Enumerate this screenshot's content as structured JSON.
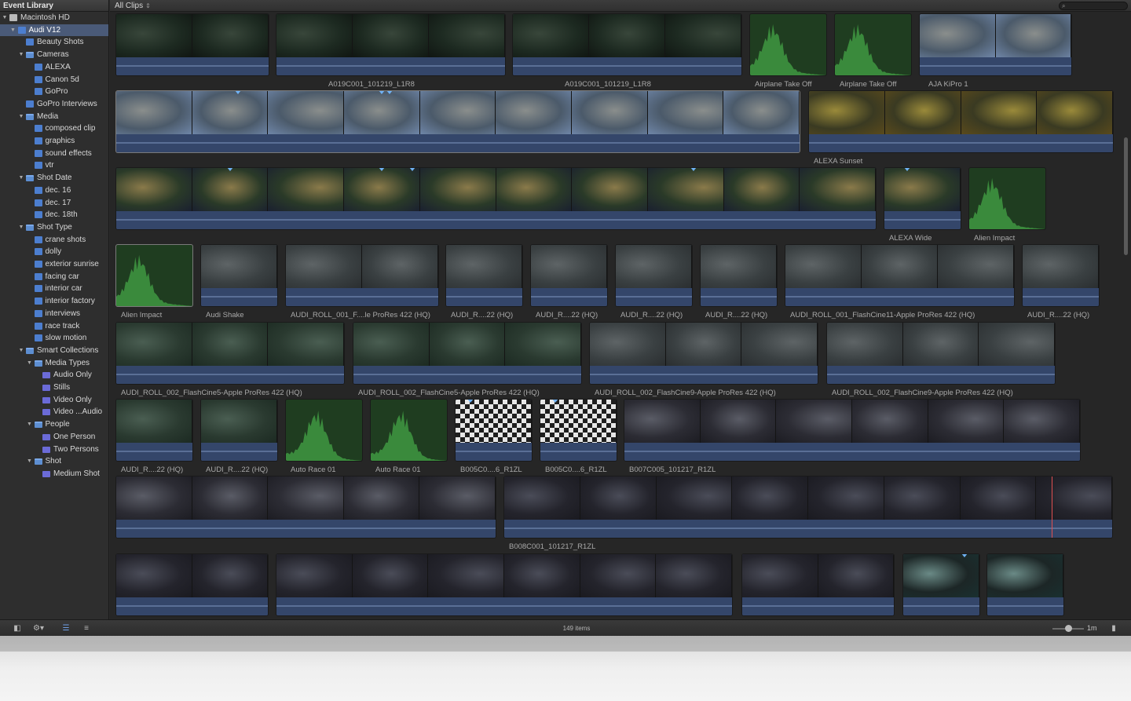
{
  "sidebar": {
    "header": "Event Library",
    "items": [
      {
        "label": "Macintosh HD",
        "depth": 0,
        "icon": "hard-drive-icon",
        "expanded": true,
        "selected": false
      },
      {
        "label": "Audi V12",
        "depth": 1,
        "icon": "event-icon",
        "expanded": true,
        "selected": true
      },
      {
        "label": "Beauty Shots",
        "depth": 2,
        "icon": "keyword-collection-icon",
        "expanded": null,
        "selected": false
      },
      {
        "label": "Cameras",
        "depth": 2,
        "icon": "folder-icon",
        "expanded": true,
        "selected": false
      },
      {
        "label": "ALEXA",
        "depth": 3,
        "icon": "keyword-collection-icon",
        "expanded": null,
        "selected": false
      },
      {
        "label": "Canon 5d",
        "depth": 3,
        "icon": "keyword-collection-icon",
        "expanded": null,
        "selected": false
      },
      {
        "label": "GoPro",
        "depth": 3,
        "icon": "keyword-collection-icon",
        "expanded": null,
        "selected": false
      },
      {
        "label": "GoPro Interviews",
        "depth": 2,
        "icon": "keyword-collection-icon",
        "expanded": null,
        "selected": false
      },
      {
        "label": "Media",
        "depth": 2,
        "icon": "folder-icon",
        "expanded": true,
        "selected": false
      },
      {
        "label": "composed clip",
        "depth": 3,
        "icon": "keyword-collection-icon",
        "expanded": null,
        "selected": false
      },
      {
        "label": "graphics",
        "depth": 3,
        "icon": "keyword-collection-icon",
        "expanded": null,
        "selected": false
      },
      {
        "label": "sound effects",
        "depth": 3,
        "icon": "keyword-collection-icon",
        "expanded": null,
        "selected": false
      },
      {
        "label": "vtr",
        "depth": 3,
        "icon": "keyword-collection-icon",
        "expanded": null,
        "selected": false
      },
      {
        "label": "Shot Date",
        "depth": 2,
        "icon": "folder-icon",
        "expanded": true,
        "selected": false
      },
      {
        "label": "dec. 16",
        "depth": 3,
        "icon": "keyword-collection-icon",
        "expanded": null,
        "selected": false
      },
      {
        "label": "dec. 17",
        "depth": 3,
        "icon": "keyword-collection-icon",
        "expanded": null,
        "selected": false
      },
      {
        "label": "dec. 18th",
        "depth": 3,
        "icon": "keyword-collection-icon",
        "expanded": null,
        "selected": false
      },
      {
        "label": "Shot Type",
        "depth": 2,
        "icon": "folder-icon",
        "expanded": true,
        "selected": false
      },
      {
        "label": "crane shots",
        "depth": 3,
        "icon": "keyword-collection-icon",
        "expanded": null,
        "selected": false
      },
      {
        "label": "dolly",
        "depth": 3,
        "icon": "keyword-collection-icon",
        "expanded": null,
        "selected": false
      },
      {
        "label": "exterior sunrise",
        "depth": 3,
        "icon": "keyword-collection-icon",
        "expanded": null,
        "selected": false
      },
      {
        "label": "facing car",
        "depth": 3,
        "icon": "keyword-collection-icon",
        "expanded": null,
        "selected": false
      },
      {
        "label": "interior car",
        "depth": 3,
        "icon": "keyword-collection-icon",
        "expanded": null,
        "selected": false
      },
      {
        "label": "interior factory",
        "depth": 3,
        "icon": "keyword-collection-icon",
        "expanded": null,
        "selected": false
      },
      {
        "label": "interviews",
        "depth": 3,
        "icon": "keyword-collection-icon",
        "expanded": null,
        "selected": false
      },
      {
        "label": "race track",
        "depth": 3,
        "icon": "keyword-collection-icon",
        "expanded": null,
        "selected": false
      },
      {
        "label": "slow motion",
        "depth": 3,
        "icon": "keyword-collection-icon",
        "expanded": null,
        "selected": false
      },
      {
        "label": "Smart Collections",
        "depth": 2,
        "icon": "folder-icon",
        "expanded": true,
        "selected": false
      },
      {
        "label": "Media Types",
        "depth": 3,
        "icon": "folder-icon",
        "expanded": true,
        "selected": false
      },
      {
        "label": "Audio Only",
        "depth": 4,
        "icon": "smart-collection-icon",
        "expanded": null,
        "selected": false
      },
      {
        "label": "Stills",
        "depth": 4,
        "icon": "smart-collection-icon",
        "expanded": null,
        "selected": false
      },
      {
        "label": "Video Only",
        "depth": 4,
        "icon": "smart-collection-icon",
        "expanded": null,
        "selected": false
      },
      {
        "label": "Video ...Audio",
        "depth": 4,
        "icon": "smart-collection-icon",
        "expanded": null,
        "selected": false
      },
      {
        "label": "People",
        "depth": 3,
        "icon": "folder-icon",
        "expanded": true,
        "selected": false
      },
      {
        "label": "One Person",
        "depth": 4,
        "icon": "smart-collection-icon",
        "expanded": null,
        "selected": false
      },
      {
        "label": "Two Persons",
        "depth": 4,
        "icon": "smart-collection-icon",
        "expanded": null,
        "selected": false
      },
      {
        "label": "Shot",
        "depth": 3,
        "icon": "folder-icon",
        "expanded": true,
        "selected": false
      },
      {
        "label": "Medium Shot",
        "depth": 4,
        "icon": "smart-collection-icon",
        "expanded": null,
        "selected": false
      }
    ]
  },
  "topbar": {
    "filter_label": "All Clips",
    "filter_arrow": "⇕",
    "search_icon": "search-icon",
    "search_glyph": "⌕"
  },
  "clips": [
    {
      "label": "",
      "kind": "video",
      "tint": "tunnel",
      "frames": 2,
      "markers": []
    },
    {
      "label": "A019C001_101219_L1R8",
      "kind": "video",
      "tint": "tunnel",
      "frames": 3,
      "markers": []
    },
    {
      "label": "A019C001_101219_L1R8",
      "kind": "video",
      "tint": "tunnel",
      "frames": 3,
      "markers": []
    },
    {
      "label": "Airplane Take Off",
      "kind": "audio",
      "tint": "green",
      "frames": 1,
      "markers": []
    },
    {
      "label": "Airplane Take Off",
      "kind": "audio",
      "tint": "green",
      "frames": 1,
      "markers": []
    },
    {
      "label": "AJA KiPro 1",
      "kind": "video",
      "tint": "track",
      "frames": 2,
      "markers": []
    },
    {
      "label": "",
      "kind": "video",
      "tint": "track",
      "frames": 9,
      "markers": [
        1.6,
        3.5,
        3.6
      ],
      "selected": true
    },
    {
      "label": "ALEXA Sunset",
      "kind": "video",
      "tint": "sunset",
      "frames": 4,
      "markers": []
    },
    {
      "label": "",
      "kind": "video",
      "tint": "sunrise",
      "frames": 10,
      "markers": [
        1.5,
        3.5,
        3.9,
        7.6
      ]
    },
    {
      "label": "ALEXA Wide",
      "kind": "video",
      "tint": "sunrise",
      "frames": 1,
      "markers": [
        0.3
      ]
    },
    {
      "label": "Alien Impact",
      "kind": "audio",
      "tint": "green",
      "frames": 1,
      "markers": []
    },
    {
      "label": "Alien Impact",
      "kind": "audio",
      "tint": "green",
      "frames": 1,
      "markers": [],
      "selected": true
    },
    {
      "label": "Audi Shake",
      "kind": "video",
      "tint": "rain",
      "frames": 1,
      "markers": []
    },
    {
      "label": "AUDI_ROLL_001_F....le ProRes 422 (HQ)",
      "kind": "video",
      "tint": "rain",
      "frames": 2,
      "markers": []
    },
    {
      "label": "AUDI_R....22 (HQ)",
      "kind": "video",
      "tint": "rain",
      "frames": 1,
      "markers": []
    },
    {
      "label": "AUDI_R....22 (HQ)",
      "kind": "video",
      "tint": "rain",
      "frames": 1,
      "markers": []
    },
    {
      "label": "AUDI_R....22 (HQ)",
      "kind": "video",
      "tint": "rain",
      "frames": 1,
      "markers": []
    },
    {
      "label": "AUDI_R....22 (HQ)",
      "kind": "video",
      "tint": "rain",
      "frames": 1,
      "markers": []
    },
    {
      "label": "AUDI_ROLL_001_FlashCine11-Apple ProRes 422 (HQ)",
      "kind": "video",
      "tint": "rain",
      "frames": 3,
      "markers": []
    },
    {
      "label": "AUDI_R....22 (HQ)",
      "kind": "video",
      "tint": "rain",
      "frames": 1,
      "markers": []
    },
    {
      "label": "AUDI_ROLL_002_FlashCine5-Apple ProRes 422 (HQ)",
      "kind": "video",
      "tint": "wet",
      "frames": 3,
      "markers": []
    },
    {
      "label": "AUDI_ROLL_002_FlashCine5-Apple ProRes 422 (HQ)",
      "kind": "video",
      "tint": "wet",
      "frames": 3,
      "markers": []
    },
    {
      "label": "AUDI_ROLL_002_FlashCine9-Apple ProRes 422 (HQ)",
      "kind": "video",
      "tint": "rain",
      "frames": 3,
      "markers": []
    },
    {
      "label": "AUDI_ROLL_002_FlashCine9-Apple ProRes 422 (HQ)",
      "kind": "video",
      "tint": "rain",
      "frames": 3,
      "markers": []
    },
    {
      "label": "AUDI_R....22 (HQ)",
      "kind": "video",
      "tint": "wet",
      "frames": 1,
      "markers": []
    },
    {
      "label": "AUDI_R....22 (HQ)",
      "kind": "video",
      "tint": "wet",
      "frames": 1,
      "markers": []
    },
    {
      "label": "Auto Race 01",
      "kind": "audio",
      "tint": "green",
      "frames": 1,
      "markers": []
    },
    {
      "label": "Auto Race 01",
      "kind": "audio",
      "tint": "green",
      "frames": 1,
      "markers": []
    },
    {
      "label": "B005C0....6_R1ZL",
      "kind": "video",
      "tint": "checker",
      "frames": 1,
      "markers": [
        0.2
      ]
    },
    {
      "label": "B005C0....6_R1ZL",
      "kind": "video",
      "tint": "checker",
      "frames": 1,
      "markers": [
        0.2
      ]
    },
    {
      "label": "B007C005_101217_R1ZL",
      "kind": "video",
      "tint": "interview",
      "frames": 6,
      "markers": []
    },
    {
      "label": "",
      "kind": "video",
      "tint": "interview",
      "frames": 5,
      "markers": []
    },
    {
      "label": "B008C001_101217_R1ZL",
      "kind": "video",
      "tint": "interview2",
      "frames": 8,
      "markers": [],
      "playhead": 0.9
    },
    {
      "label": "",
      "kind": "video",
      "tint": "interview2",
      "frames": 2,
      "markers": []
    },
    {
      "label": "",
      "kind": "video",
      "tint": "interview2",
      "frames": 6,
      "markers": []
    },
    {
      "label": "",
      "kind": "video",
      "tint": "interview2",
      "frames": 2,
      "markers": []
    },
    {
      "label": "",
      "kind": "video",
      "tint": "factory",
      "frames": 1,
      "markers": [
        0.8
      ]
    },
    {
      "label": "",
      "kind": "video",
      "tint": "factory",
      "frames": 1,
      "markers": []
    }
  ],
  "bottombar": {
    "item_count": "149 items",
    "zoom_label": "1m",
    "buttons": [
      {
        "name": "toggle-library-button",
        "icon": "sidebar-icon",
        "glyph": "◧"
      },
      {
        "name": "action-menu-button",
        "icon": "gear-icon",
        "glyph": "⚙▾"
      },
      {
        "name": "filmstrip-view-button",
        "icon": "filmstrip-icon",
        "glyph": "☰"
      },
      {
        "name": "list-view-button",
        "icon": "list-icon",
        "glyph": "≡"
      },
      {
        "name": "clip-appearance-button",
        "icon": "appearance-icon",
        "glyph": "▮"
      }
    ]
  },
  "colors": {
    "accent": "#4a5a78",
    "audio_strip": "#34466a",
    "waveform_green": "#3a8a3c",
    "marker": "#6fb2f5",
    "playhead": "#e05050"
  }
}
